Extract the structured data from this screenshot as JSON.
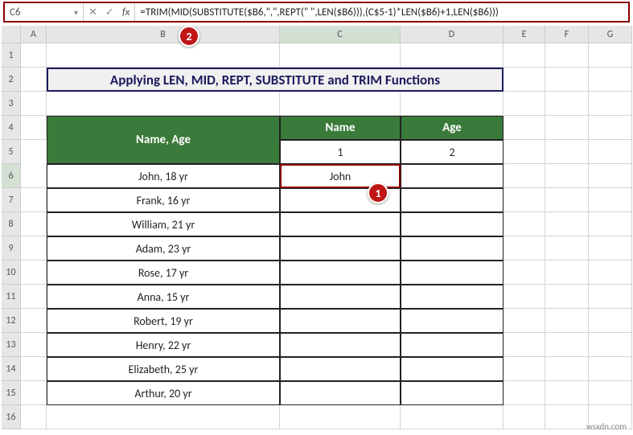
{
  "namebox": {
    "value": "C6"
  },
  "formula_bar": {
    "cancel_icon": "✕",
    "enter_icon": "✓",
    "fx_label": "fx",
    "formula": "=TRIM(MID(SUBSTITUTE($B6,\",\",REPT(\" \",LEN($B6))),(C$5-1)*LEN($B6)+1,LEN($B6)))"
  },
  "columns": {
    "A": "A",
    "B": "B",
    "C": "C",
    "D": "D",
    "E": "E",
    "F": "F",
    "G": "G"
  },
  "rows": [
    "1",
    "2",
    "3",
    "4",
    "5",
    "6",
    "7",
    "8",
    "9",
    "10",
    "11",
    "12",
    "13",
    "14",
    "15",
    "16"
  ],
  "title": "Applying LEN, MID, REPT, SUBSTITUTE and TRIM Functions",
  "headers": {
    "name_age": "Name, Age",
    "name": "Name",
    "age": "Age"
  },
  "subhead": {
    "name_idx": "1",
    "age_idx": "2"
  },
  "data": {
    "r6": {
      "b": "John, 18 yr",
      "c": "John",
      "d": ""
    },
    "r7": {
      "b": "Frank, 16 yr",
      "c": "",
      "d": ""
    },
    "r8": {
      "b": "William, 21 yr",
      "c": "",
      "d": ""
    },
    "r9": {
      "b": "Adam, 23 yr",
      "c": "",
      "d": ""
    },
    "r10": {
      "b": "Rose, 17 yr",
      "c": "",
      "d": ""
    },
    "r11": {
      "b": "Anna, 15 yr",
      "c": "",
      "d": ""
    },
    "r12": {
      "b": "Robert, 19 yr",
      "c": "",
      "d": ""
    },
    "r13": {
      "b": "Henry, 22 yr",
      "c": "",
      "d": ""
    },
    "r14": {
      "b": "Elizabeth, 25 yr",
      "c": "",
      "d": ""
    },
    "r15": {
      "b": "Arthur, 20 yr",
      "c": "",
      "d": ""
    }
  },
  "callouts": {
    "one": "1",
    "two": "2"
  },
  "watermark": "wsxdn.com"
}
